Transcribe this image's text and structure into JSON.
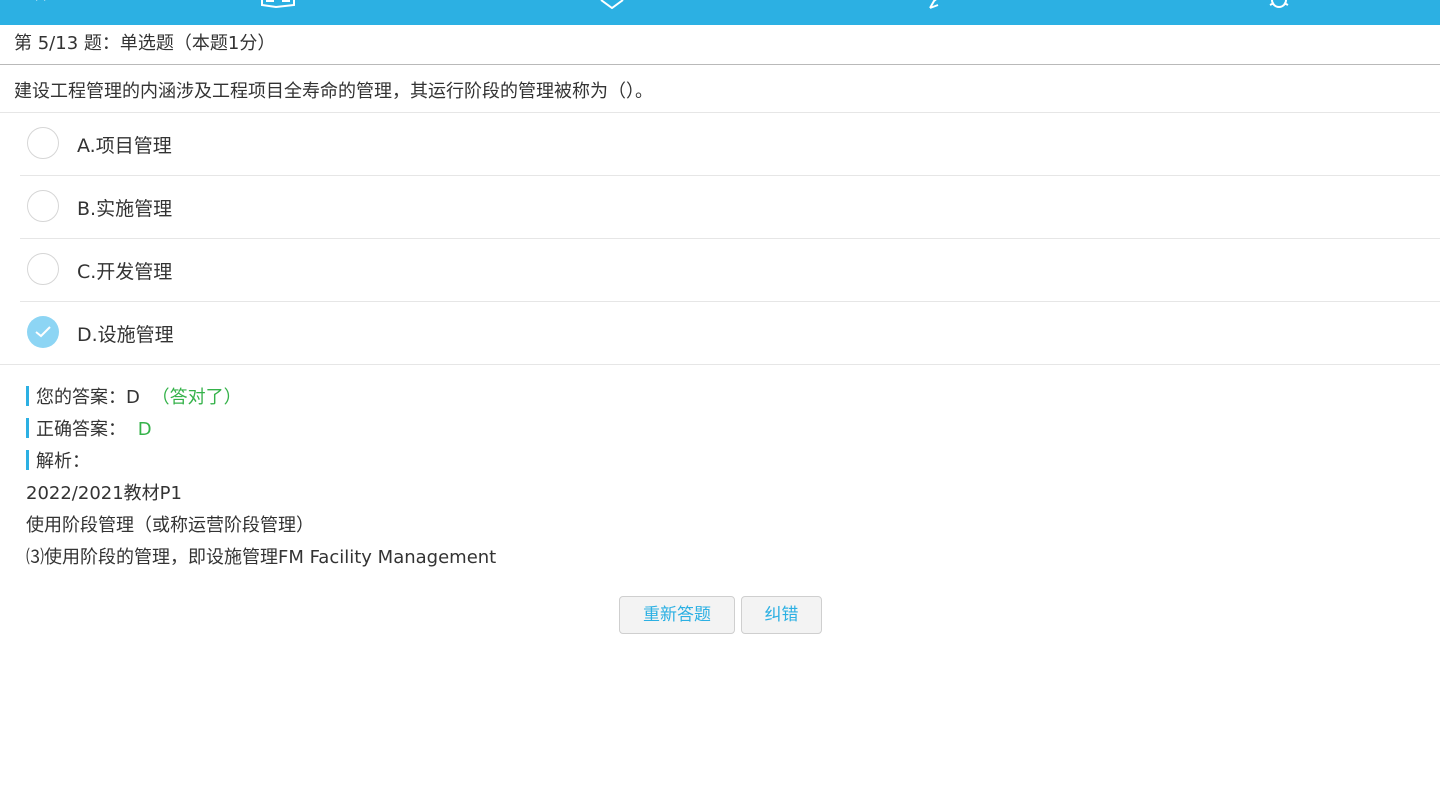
{
  "header": {
    "question_number": "第 5/13 题：单选题（本题1分）"
  },
  "question": {
    "stem": "建设工程管理的内涵涉及工程项目全寿命的管理，其运行阶段的管理被称为（）。",
    "options": [
      {
        "label": "A.项目管理",
        "selected": false
      },
      {
        "label": "B.实施管理",
        "selected": false
      },
      {
        "label": "C.开发管理",
        "selected": false
      },
      {
        "label": "D.设施管理",
        "selected": true
      }
    ]
  },
  "result": {
    "your_answer_label": "您的答案：",
    "your_answer_value": "D",
    "correct_note": "（答对了）",
    "correct_answer_label": "正确答案：",
    "correct_answer_value": "D",
    "analysis_label": "解析：",
    "analysis_lines": [
      "2022/2021教材P1",
      "使用阶段管理（或称运营阶段管理）",
      "⑶使用阶段的管理，即设施管理FM Facility Management"
    ]
  },
  "buttons": {
    "retry": "重新答题",
    "report": "纠错"
  },
  "colors": {
    "accent": "#2cb0e3",
    "correct": "#35b24a",
    "selected_radio": "#8dd5f4"
  },
  "icons": [
    "back-icon",
    "book-icon",
    "tag-icon",
    "pen-icon",
    "settings-icon",
    "check-icon"
  ]
}
